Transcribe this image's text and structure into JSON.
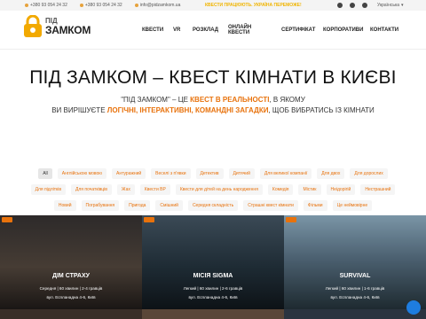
{
  "topbar": {
    "phone1": "+380 93 054 24 32",
    "phone2": "+380 93 054 24 32",
    "email": "info@pidzamkom.ua",
    "news": "КВЕСТИ ПРАЦЮЮТЬ. УКРАЇНА ПЕРЕМОЖЕ!",
    "lang": "Українська"
  },
  "logo": {
    "line1": "ПІД",
    "line2": "ЗАМКОМ"
  },
  "nav": [
    "КВЕСТИ",
    "VR",
    "РОЗКЛАД",
    "ОНЛАЙН КВЕСТИ",
    "СЕРТИФІКАТ",
    "КОРПОРАТИВИ",
    "КОНТАКТИ"
  ],
  "hero": {
    "title": "ПІД ЗАМКОМ – КВЕСТ КІМНАТИ В КИЄВІ",
    "line1a": "\"ПІД ЗАМКОМ\" – ЦЕ ",
    "line1b": "КВЕСТ В РЕАЛЬНОСТІ",
    "line1c": ", В ЯКОМУ",
    "line2a": "ВИ ВИРІШУЄТЕ ",
    "line2b": "ЛОГІЧНІ, ІНТЕРАКТИВНІ, КОМАНДНІ ЗАГАДКИ",
    "line2c": ", ЩОБ ВИБРАТИСЬ ІЗ КІМНАТИ"
  },
  "filters": {
    "row1": [
      "All",
      "Англійською мовою",
      "Антуражний",
      "Веселі з п'явки",
      "Детектив",
      "Дитячий",
      "Для великої компанії",
      "Для двох",
      "Для дорослих"
    ],
    "row2": [
      "Для підлітків",
      "Для початківців",
      "Жах",
      "Квести ВР",
      "Квести для дітей на день народження",
      "Комедія",
      "Містик",
      "Неідорігій",
      "Нестрашний"
    ],
    "row3": [
      "Новий",
      "Пограбування",
      "Пригода",
      "Смішний",
      "Середня складність",
      "Страшні квест кімнати",
      "Фільми",
      "Це неймовірне"
    ]
  },
  "cards": [
    {
      "name": "ДІМ СТРАХУ",
      "meta": "Середня | 60 хвилин | 2-4 гравців",
      "addr": "вул. Еспланадна 4-6, Київ"
    },
    {
      "name": "МІСІЯ SIGMA",
      "meta": "Легкий | 60 хвилин | 2-6 гравців",
      "addr": "вул. Еспланадна 4-6, Київ"
    },
    {
      "name": "SURVIVAL",
      "meta": "Легкий | 60 хвилин | 1-6 гравців",
      "addr": "вул. Еспланадна 4-6, Київ"
    }
  ]
}
